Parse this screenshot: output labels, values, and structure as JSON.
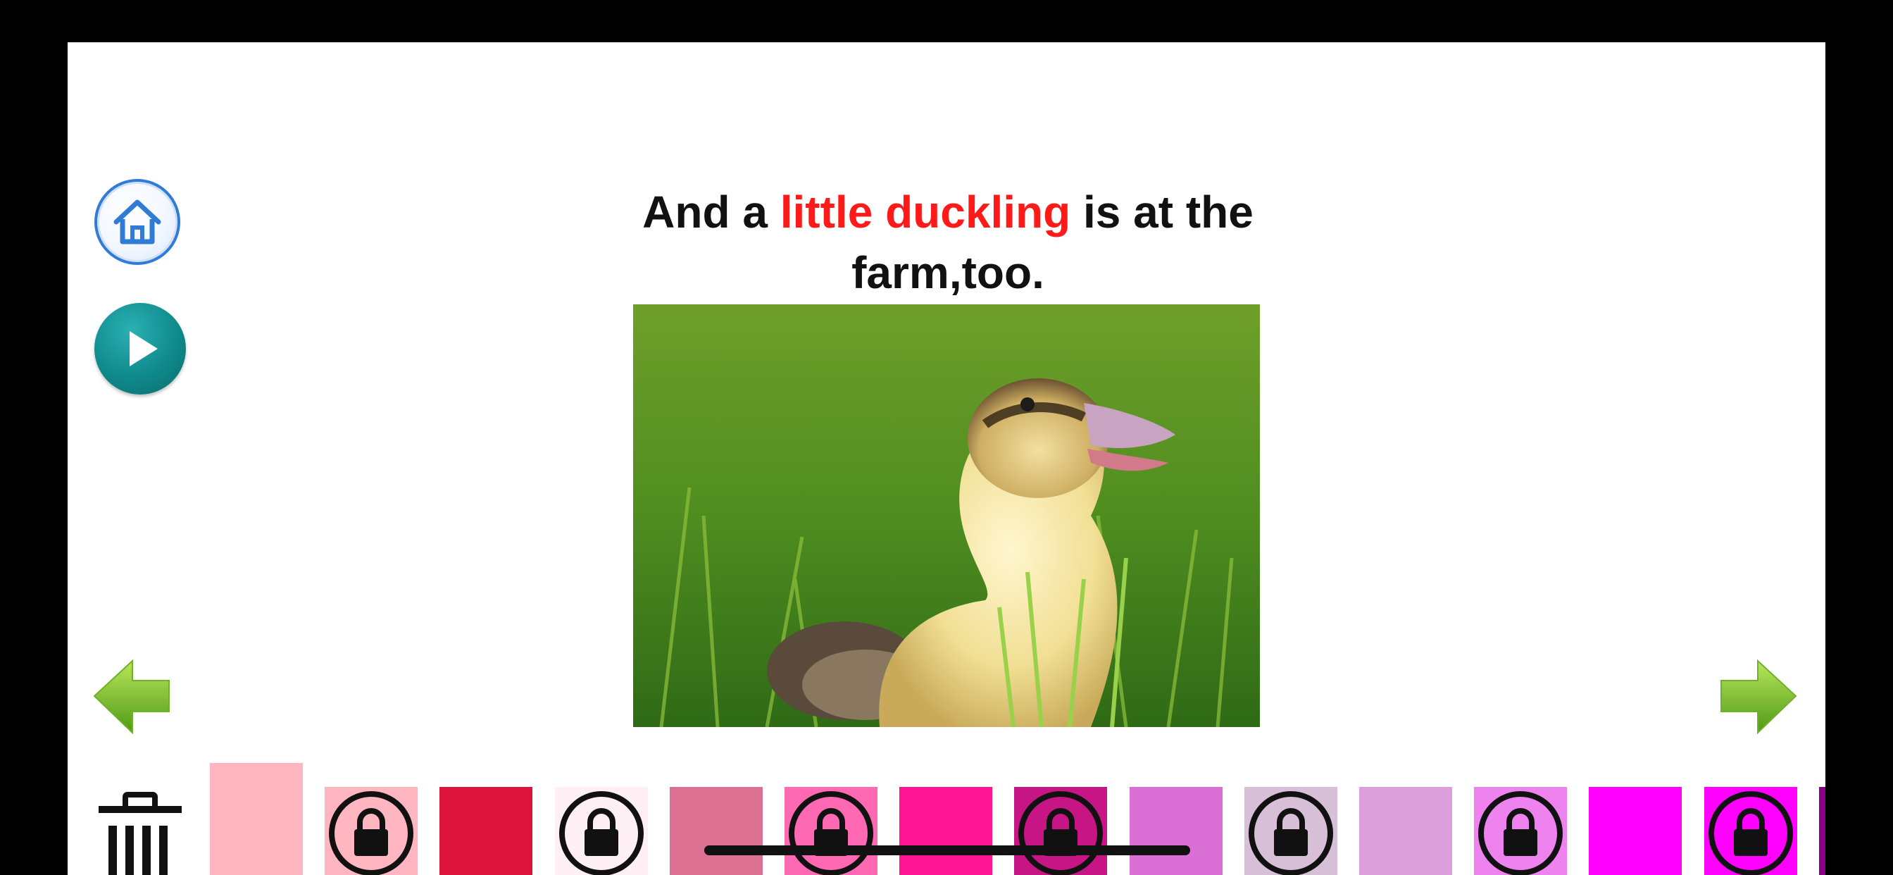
{
  "story": {
    "text_before": "And a ",
    "text_highlight": "little duckling",
    "text_after": " is at the farm,too.",
    "highlight_color": "#ff1a1a"
  },
  "toolbar": {
    "home_icon": "home-icon",
    "play_icon": "play-icon",
    "prev_icon": "arrow-left-icon",
    "next_icon": "arrow-right-icon",
    "trash_icon": "trash-icon"
  },
  "palette": {
    "colors": [
      {
        "color": "#ffb6c1",
        "locked": false,
        "selected": true
      },
      {
        "color": "#ffb6c1",
        "locked": true,
        "selected": false
      },
      {
        "color": "#dc143c",
        "locked": false,
        "selected": false
      },
      {
        "color": "#fff0f5",
        "locked": true,
        "selected": false
      },
      {
        "color": "#db7093",
        "locked": false,
        "selected": false
      },
      {
        "color": "#ff69b4",
        "locked": true,
        "selected": false
      },
      {
        "color": "#ff1493",
        "locked": false,
        "selected": false
      },
      {
        "color": "#c71585",
        "locked": true,
        "selected": false
      },
      {
        "color": "#da70d6",
        "locked": false,
        "selected": false
      },
      {
        "color": "#d8bfd8",
        "locked": true,
        "selected": false
      },
      {
        "color": "#dda0dd",
        "locked": false,
        "selected": false
      },
      {
        "color": "#ee82ee",
        "locked": true,
        "selected": false
      },
      {
        "color": "#ff00ff",
        "locked": false,
        "selected": false
      },
      {
        "color": "#ff00ff",
        "locked": true,
        "selected": false
      },
      {
        "color": "#8b008b",
        "locked": false,
        "selected": false
      }
    ]
  }
}
